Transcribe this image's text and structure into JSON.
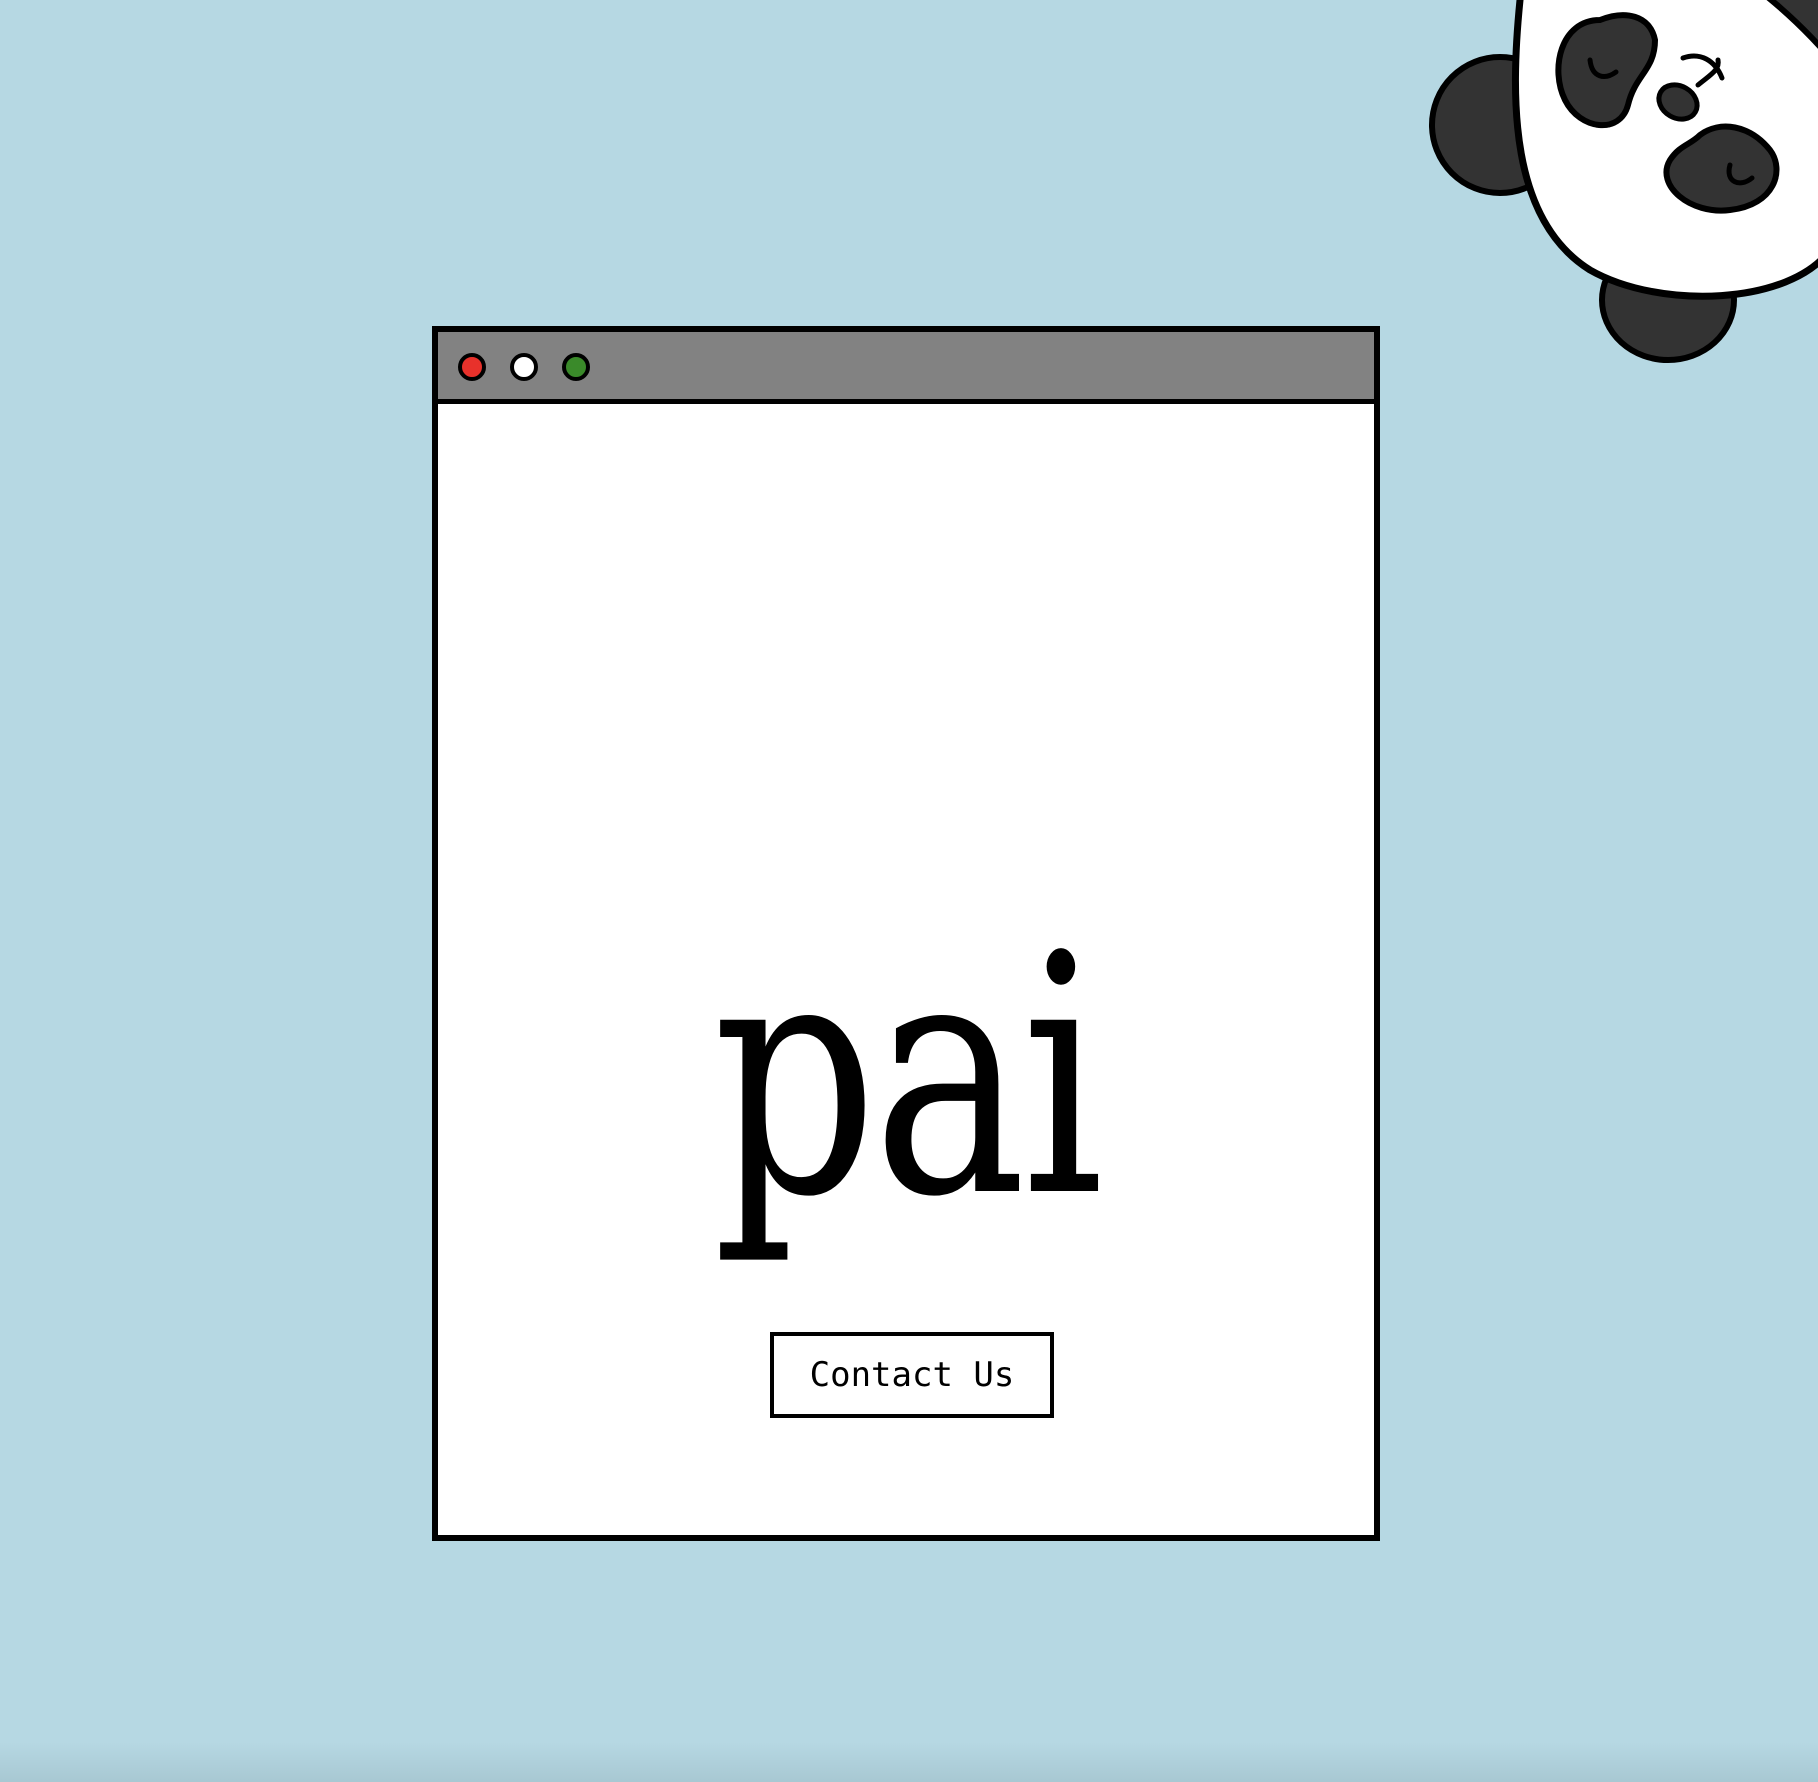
{
  "page": {
    "background_color": "#b6d8e3"
  },
  "window": {
    "titlebar_color": "#828282",
    "buttons": [
      {
        "name": "close",
        "color": "#e8312b"
      },
      {
        "name": "minimize",
        "color": "#ffffff"
      },
      {
        "name": "maximize",
        "color": "#3a8a2a"
      }
    ]
  },
  "main": {
    "logo_text": "pai",
    "contact_button_label": "Contact Us"
  },
  "decoration": {
    "icon": "panda-icon"
  }
}
